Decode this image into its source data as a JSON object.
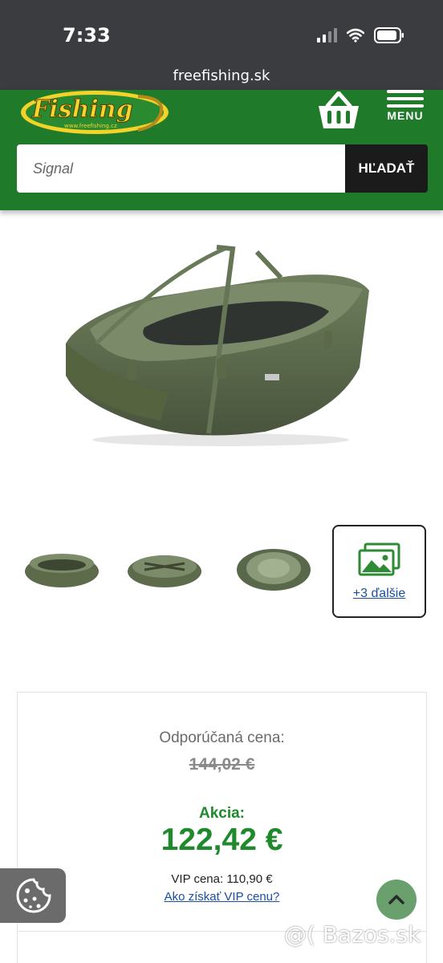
{
  "status_bar": {
    "time": "7:33",
    "url": "freefishing.sk"
  },
  "header": {
    "logo_text": "Fishing",
    "logo_subtext": "www.freefishing.cz",
    "menu_label": "MENU",
    "search": {
      "placeholder": "Signal",
      "button_label": "HĽADAŤ"
    }
  },
  "gallery": {
    "more_label": "+3 ďalšie"
  },
  "price": {
    "recommended_label": "Odporúčaná cena:",
    "old_price": "144,02 €",
    "sale_label": "Akcia:",
    "sale_price": "122,42 €",
    "vip_price": "VIP cena: 110,90 €",
    "vip_link": "Ako získať VIP cenu?"
  },
  "watermark": "@( Bazos.sk",
  "colors": {
    "brand_green": "#1f7a2a",
    "price_green": "#1f8a2c",
    "link_blue": "#1a4fa0"
  }
}
